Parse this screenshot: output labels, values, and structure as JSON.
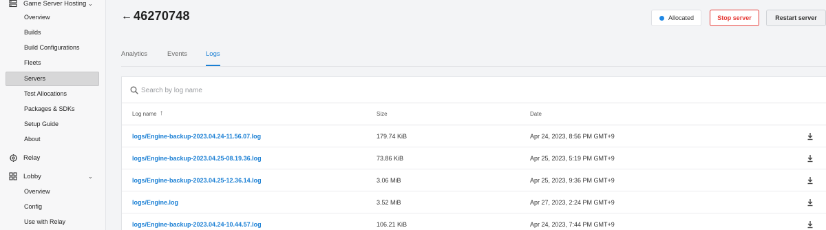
{
  "sidebar": {
    "groups": [
      {
        "label": "Game Server Hosting",
        "icon": "server-stack-icon",
        "expanded": true
      },
      {
        "label": "Relay",
        "icon": "relay-icon"
      },
      {
        "label": "Lobby",
        "icon": "lobby-icon",
        "expanded": true
      }
    ],
    "gsh_items": [
      "Overview",
      "Builds",
      "Build Configurations",
      "Fleets",
      "Servers",
      "Test Allocations",
      "Packages & SDKs",
      "Setup Guide",
      "About"
    ],
    "lobby_items": [
      "Overview",
      "Config",
      "Use with Relay"
    ],
    "selected": "Servers"
  },
  "header": {
    "back_icon": "arrow-left-icon",
    "title": "46270748",
    "status": "Allocated",
    "status_color": "#1f88e5",
    "stop_label": "Stop server",
    "restart_label": "Restart server"
  },
  "tabs": [
    {
      "label": "Analytics"
    },
    {
      "label": "Events"
    },
    {
      "label": "Logs",
      "active": true
    }
  ],
  "search": {
    "placeholder": "Search by log name"
  },
  "table": {
    "columns": {
      "name": "Log name",
      "size": "Size",
      "date": "Date"
    },
    "sort": {
      "column": "Log name",
      "direction": "ascending"
    },
    "rows": [
      {
        "name": "logs/Engine-backup-2023.04.24-11.56.07.log",
        "size": "179.74 KiB",
        "date": "Apr 24, 2023, 8:56 PM GMT+9"
      },
      {
        "name": "logs/Engine-backup-2023.04.25-08.19.36.log",
        "size": "73.86 KiB",
        "date": "Apr 25, 2023, 5:19 PM GMT+9"
      },
      {
        "name": "logs/Engine-backup-2023.04.25-12.36.14.log",
        "size": "3.06 MiB",
        "date": "Apr 25, 2023, 9:36 PM GMT+9"
      },
      {
        "name": "logs/Engine.log",
        "size": "3.52 MiB",
        "date": "Apr 27, 2023, 2:24 PM GMT+9"
      },
      {
        "name": "logs/Engine-backup-2023.04.24-10.44.57.log",
        "size": "106.21 KiB",
        "date": "Apr 24, 2023, 7:44 PM GMT+9"
      }
    ]
  },
  "colors": {
    "accent": "#1a7fd4",
    "danger": "#e53935"
  }
}
